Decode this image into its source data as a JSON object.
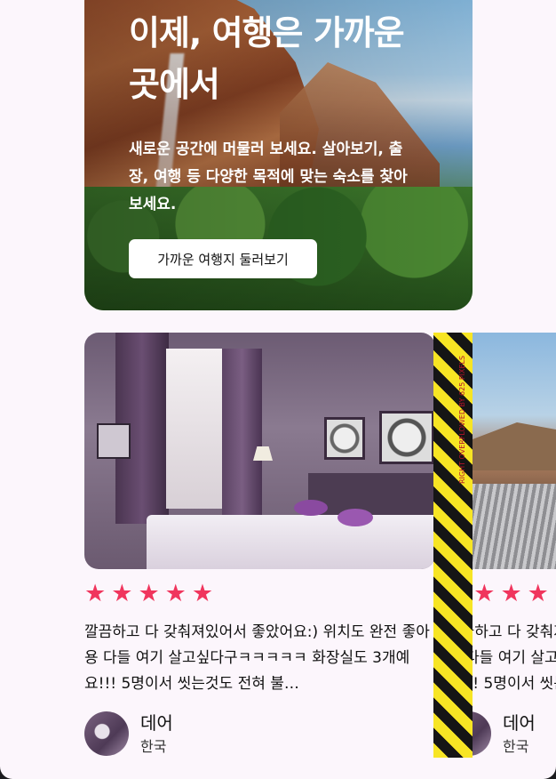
{
  "hero": {
    "title": "이제, 여행은 가까운 곳에서",
    "description": "새로운 공간에 머물러 보세요. 살아보기, 출장, 여행 등 다양한 목적에 맞는 숙소를 찾아보세요.",
    "button_label": "가까운 여행지 둘러보기"
  },
  "reviews": [
    {
      "rating": 5,
      "stars": [
        "★",
        "★",
        "★",
        "★",
        "★"
      ],
      "text": "깔끔하고 다 갖춰져있어서 좋았어요:) 위치도 완전 좋아용 다들 여기 살고싶다구ㅋㅋㅋㅋㅋ 화장실도 3개예요!!! 5명이서 씻는것도 전혀 불…",
      "author": "데어",
      "country": "한국"
    },
    {
      "rating": 5,
      "stars": [
        "★",
        "★",
        "★",
        "★",
        "★"
      ],
      "text": "깔끔하고 다 갖춰져있어서 좋았어요:) 위치도 완전 좋아용 다들 여기 살고싶다구ㅋㅋㅋㅋㅋ 화장실도 3개예요!!! 5명이서 씻는것도 전혀 불…",
      "author": "데어",
      "country": "한국"
    }
  ],
  "overflow_label": "RIGHT OVERFLOWED BY 625 PIXELS",
  "colors": {
    "accent_star": "#f0355d",
    "background": "#fcf6fc",
    "overflow_yellow": "#f7e524"
  }
}
